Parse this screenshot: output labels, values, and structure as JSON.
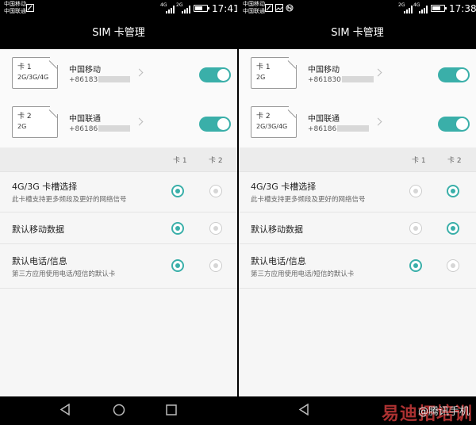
{
  "panels": [
    {
      "status": {
        "carrier1": "中国移动",
        "carrier2": "中国联通",
        "net_tag_1": "4G",
        "net_tag_2": "2G",
        "time": "17:41"
      },
      "title": "SIM 卡管理",
      "sims": [
        {
          "card": "卡 1",
          "networks": "2G/3G/4G",
          "carrier": "中国移动",
          "number": "+86183",
          "enabled": true
        },
        {
          "card": "卡 2",
          "networks": "2G",
          "carrier": "中国联通",
          "number": "+86186",
          "enabled": true
        }
      ],
      "col_headers": [
        "卡 1",
        "卡 2"
      ],
      "options": [
        {
          "title": "4G/3G 卡槽选择",
          "subtitle": "此卡槽支持更多频段及更好的网络信号",
          "selected": "卡 1"
        },
        {
          "title": "默认移动数据",
          "subtitle": "",
          "selected": "卡 1"
        },
        {
          "title": "默认电话/信息",
          "subtitle": "第三方应用使用电话/短信的默认卡",
          "selected": "卡 1"
        }
      ]
    },
    {
      "status": {
        "carrier1": "中国移动",
        "carrier2": "中国联通",
        "net_tag_1": "2G",
        "net_tag_2": "4G",
        "time": "17:38"
      },
      "title": "SIM 卡管理",
      "sims": [
        {
          "card": "卡 1",
          "networks": "2G",
          "carrier": "中国移动",
          "number": "+861830",
          "enabled": true
        },
        {
          "card": "卡 2",
          "networks": "2G/3G/4G",
          "carrier": "中国联通",
          "number": "+86186",
          "enabled": true
        }
      ],
      "col_headers": [
        "卡 1",
        "卡 2"
      ],
      "options": [
        {
          "title": "4G/3G 卡槽选择",
          "subtitle": "此卡槽支持更多频段及更好的网络信号",
          "selected": "卡 2"
        },
        {
          "title": "默认移动数据",
          "subtitle": "",
          "selected": "卡 2"
        },
        {
          "title": "默认电话/信息",
          "subtitle": "第三方应用使用电话/短信的默认卡",
          "selected": "卡 1"
        }
      ]
    }
  ],
  "watermark": {
    "main": "易迪拓培训",
    "sub": "@腾讯手机"
  },
  "colors": {
    "accent": "#3aafa9",
    "status_bar": "#000000",
    "background": "#f6f6f6"
  },
  "icons": {
    "back": "back-triangle-icon",
    "home": "home-circle-icon",
    "recents": "recents-square-icon"
  }
}
